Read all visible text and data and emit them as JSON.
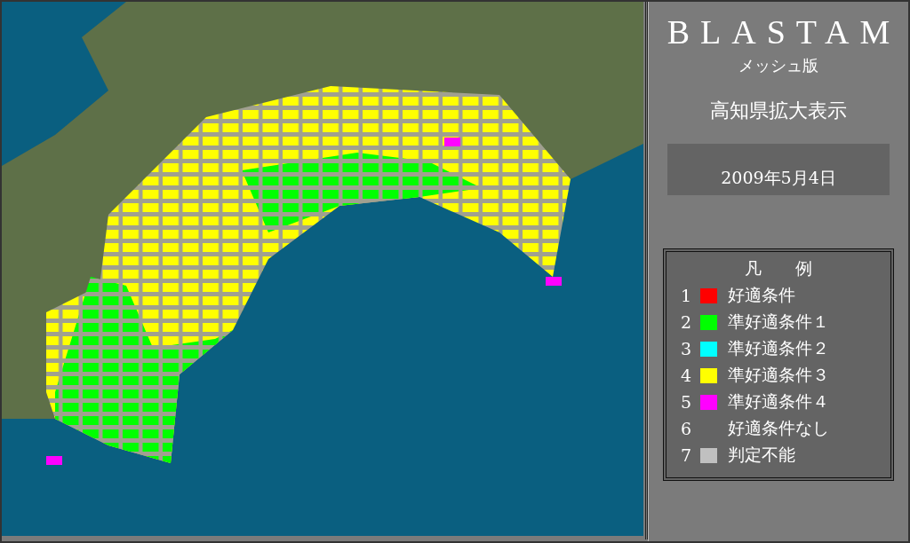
{
  "header": {
    "title": "BLASTAM",
    "subtitle": "メッシュ版",
    "region": "高知県拡大表示",
    "date": "2009年5月4日"
  },
  "legend": {
    "title": "凡　　例",
    "items": [
      {
        "number": "1",
        "label": "好適条件",
        "color": "#ff0000"
      },
      {
        "number": "2",
        "label": "準好適条件１",
        "color": "#00ff00"
      },
      {
        "number": "3",
        "label": "準好適条件２",
        "color": "#00ffff"
      },
      {
        "number": "4",
        "label": "準好適条件３",
        "color": "#ffff00"
      },
      {
        "number": "5",
        "label": "準好適条件４",
        "color": "#ff00ff"
      },
      {
        "number": "6",
        "label": "好適条件なし"
      },
      {
        "number": "7",
        "label": "判定不能",
        "color": "#c0c0c0"
      }
    ]
  }
}
